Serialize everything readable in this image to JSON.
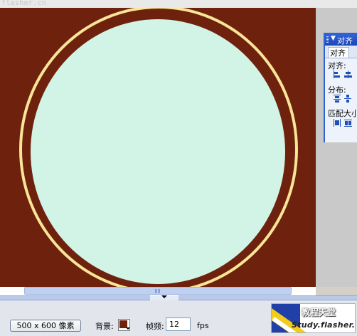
{
  "watermark": "flasher.cn",
  "stage": {
    "background_color": "#6e220e",
    "ring_color": "#f8e598",
    "disc_color": "#d1f4e7"
  },
  "align_panel": {
    "title": "对齐",
    "tab_label": "对齐",
    "sections": {
      "align": "对齐:",
      "distribute": "分布:",
      "match_size": "匹配大小"
    }
  },
  "properties": {
    "size_label": ":",
    "size_button": "500 x 600 像素",
    "bg_label": "背景:",
    "bg_color": "#6e220e",
    "fps_label": "帧频:",
    "fps_value": "12",
    "fps_unit": "fps"
  },
  "logo": {
    "title": "教程天堂",
    "site": "Study.flasher.cn"
  }
}
